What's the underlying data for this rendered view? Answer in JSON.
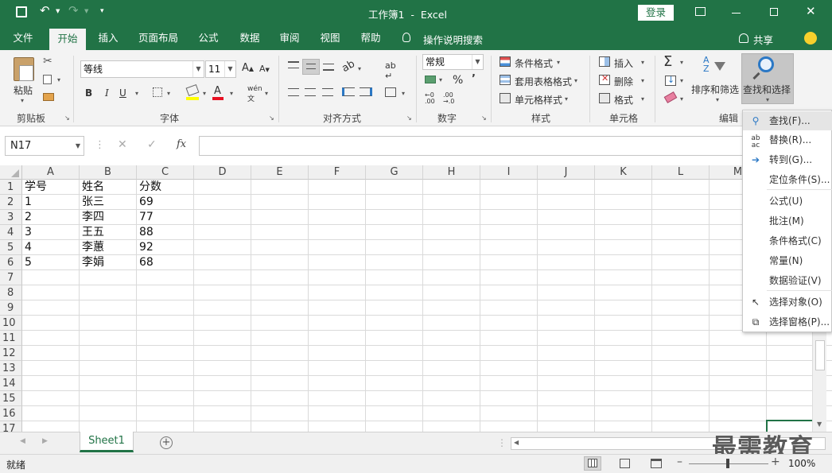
{
  "window": {
    "title": "工作簿1  -  Excel",
    "login": "登录",
    "controls": [
      "▭",
      "—",
      "☐",
      "✕"
    ]
  },
  "tabs": [
    {
      "label": "文件"
    },
    {
      "label": "开始"
    },
    {
      "label": "插入"
    },
    {
      "label": "页面布局"
    },
    {
      "label": "公式"
    },
    {
      "label": "数据"
    },
    {
      "label": "审阅"
    },
    {
      "label": "视图"
    },
    {
      "label": "帮助"
    }
  ],
  "tellme": "操作说明搜索",
  "share": "共享",
  "ribbon": {
    "paste": "粘贴",
    "font_name": "等线",
    "font_size": "11",
    "number_format": "常规",
    "percent": "%",
    "comma": "’",
    "conditional": "条件格式",
    "table_style": "套用表格格式",
    "cell_style": "单元格样式",
    "insert": "插入",
    "delete": "删除",
    "format": "格式",
    "sort": "排序和筛选",
    "find": "查找和选择",
    "groups": [
      "剪贴板",
      "字体",
      "对齐方式",
      "数字",
      "样式",
      "单元格",
      "编辑"
    ]
  },
  "formula_bar": {
    "name_box": "N17",
    "fx": "fx",
    "value": ""
  },
  "columns": [
    "A",
    "B",
    "C",
    "D",
    "E",
    "F",
    "G",
    "H",
    "I",
    "J",
    "K",
    "L",
    "M"
  ],
  "rows": [
    "1",
    "2",
    "3",
    "4",
    "5",
    "6",
    "7",
    "8",
    "9",
    "10",
    "11",
    "12",
    "13",
    "14",
    "15",
    "16",
    "17"
  ],
  "cells": [
    [
      "学号",
      "姓名",
      "分数"
    ],
    [
      "1",
      "张三",
      "69"
    ],
    [
      "2",
      "李四",
      "77"
    ],
    [
      "3",
      "王五",
      "88"
    ],
    [
      "4",
      "李蕙",
      "92"
    ],
    [
      "5",
      "李娟",
      "68"
    ]
  ],
  "sheet_tab": "Sheet1",
  "status": {
    "ready": "就绪",
    "zoom": "100%"
  },
  "menu": [
    {
      "label": "查找(F)...",
      "icon": "search-icon"
    },
    {
      "label": "替换(R)...",
      "icon": "replace-icon"
    },
    {
      "label": "转到(G)...",
      "icon": "arrow-right-icon"
    },
    {
      "label": "定位条件(S)...",
      "icon": ""
    },
    {
      "label": "公式(U)",
      "icon": ""
    },
    {
      "label": "批注(M)",
      "icon": ""
    },
    {
      "label": "条件格式(C)",
      "icon": ""
    },
    {
      "label": "常量(N)",
      "icon": ""
    },
    {
      "label": "数据验证(V)",
      "icon": ""
    },
    {
      "label": "选择对象(O)",
      "icon": "cursor-icon"
    },
    {
      "label": "选择窗格(P)...",
      "icon": "selection-pane-icon"
    }
  ],
  "watermark": "最需教育",
  "colors": {
    "excel_green": "#217346",
    "ribbon_bg": "#f3f3f3",
    "highlight": "#e5e5e5"
  }
}
